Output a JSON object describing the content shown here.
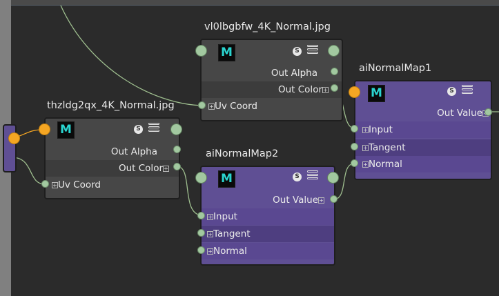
{
  "nodes": {
    "file_top": {
      "title": "vl0lbgbfw_4K_Normal.jpg",
      "icon": "maya-m-icon",
      "swatch_icon": "S",
      "out_alpha": "Out Alpha",
      "out_color": "Out Color",
      "uv_coord": "Uv Coord"
    },
    "file_left": {
      "title": "thzldg2qx_4K_Normal.jpg",
      "icon": "maya-m-icon",
      "swatch_icon": "S",
      "out_alpha": "Out Alpha",
      "out_color": "Out Color",
      "uv_coord": "Uv Coord"
    },
    "normal_map1": {
      "title": "aiNormalMap1",
      "icon": "maya-m-icon",
      "swatch_icon": "S",
      "out_value": "Out Value",
      "input": "Input",
      "tangent": "Tangent",
      "normal": "Normal"
    },
    "normal_map2": {
      "title": "aiNormalMap2",
      "icon": "maya-m-icon",
      "swatch_icon": "S",
      "out_value": "Out Value",
      "input": "Input",
      "tangent": "Tangent",
      "normal": "Normal"
    }
  },
  "plus_glyph": "+",
  "colors": {
    "file_node": "#474747",
    "normal_map_node": "#5f4f94",
    "port_green": "#a2c8a0",
    "port_orange": "#f5a623",
    "wire": "#9fbf8f",
    "icon_cyan": "#2ad4cf"
  }
}
